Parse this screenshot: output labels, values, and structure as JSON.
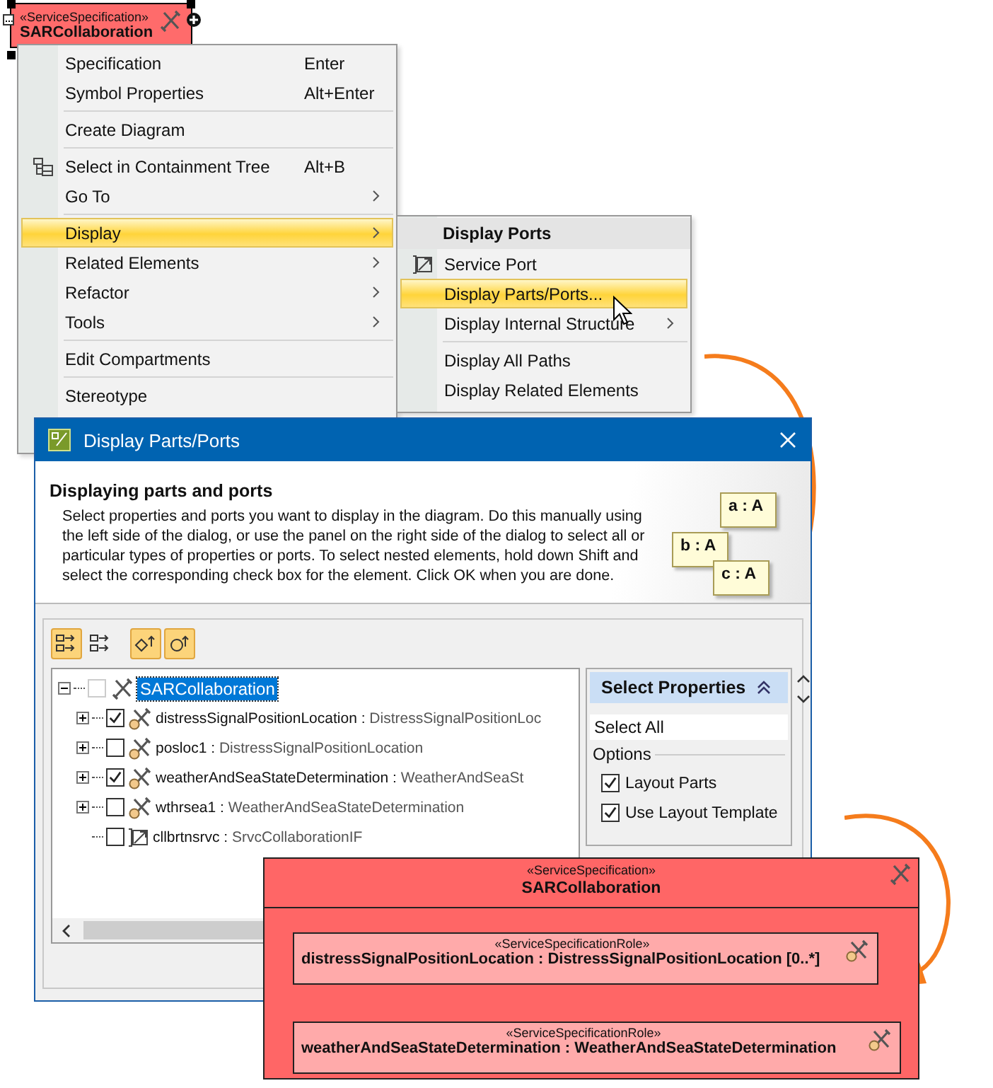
{
  "diagram_element": {
    "stereotype": "«ServiceSpecification»",
    "name": "SARCollaboration",
    "selected": true
  },
  "context_menu": {
    "groups": [
      [
        {
          "label": "Specification",
          "shortcut": "Enter",
          "has_icon": false,
          "has_submenu": false,
          "selected": false
        },
        {
          "label": "Symbol Properties",
          "shortcut": "Alt+Enter",
          "has_icon": false,
          "has_submenu": false,
          "selected": false
        }
      ],
      [
        {
          "label": "Create Diagram",
          "has_icon": false,
          "has_submenu": false,
          "selected": false
        }
      ],
      [
        {
          "label": "Select in Containment Tree",
          "shortcut": "Alt+B",
          "has_icon": true,
          "has_submenu": false,
          "selected": false
        },
        {
          "label": "Go To",
          "has_icon": false,
          "has_submenu": true,
          "selected": false
        }
      ],
      [
        {
          "label": "Display",
          "has_icon": false,
          "has_submenu": true,
          "selected": true
        },
        {
          "label": "Related Elements",
          "has_icon": false,
          "has_submenu": true,
          "selected": false
        },
        {
          "label": "Refactor",
          "has_icon": false,
          "has_submenu": true,
          "selected": false
        },
        {
          "label": "Tools",
          "has_icon": false,
          "has_submenu": true,
          "selected": false
        }
      ],
      [
        {
          "label": "Edit Compartments",
          "has_icon": false,
          "has_submenu": false,
          "selected": false
        }
      ],
      [
        {
          "label": "Stereotype",
          "has_icon": false,
          "has_submenu": false,
          "selected": false
        }
      ]
    ]
  },
  "submenu": {
    "header": "Display Ports",
    "groups": [
      [
        {
          "label": "Service Port",
          "has_icon": true,
          "has_submenu": false,
          "selected": false
        },
        {
          "label": "Display Parts/Ports...",
          "has_icon": false,
          "has_submenu": false,
          "selected": true
        },
        {
          "label": "Display Internal Structure",
          "has_icon": false,
          "has_submenu": true,
          "selected": false
        }
      ],
      [
        {
          "label": "Display All Paths",
          "has_icon": false,
          "has_submenu": false,
          "selected": false
        },
        {
          "label": "Display Related Elements",
          "has_icon": false,
          "has_submenu": false,
          "selected": false
        }
      ]
    ]
  },
  "dialog": {
    "title": "Display Parts/Ports",
    "heading": "Displaying parts and ports",
    "description": "Select properties and ports you want to display in the diagram. Do this manually using the left side of the dialog, or use the panel on the right side of the dialog to select all or particular types of properties or ports. To select nested elements, hold down Shift and select the corresponding check box for the element. Click OK when you are done.",
    "illustration_labels": [
      "a : A",
      "b : A",
      "c : A"
    ],
    "toolbar": [
      {
        "kind": "expand",
        "selected": true
      },
      {
        "kind": "collapse",
        "selected": false
      },
      {
        "kind": "part",
        "selected": true
      },
      {
        "kind": "port",
        "selected": true
      }
    ],
    "tree": {
      "name": "SARCollaboration",
      "checked": false,
      "expanded": true,
      "selected": true,
      "children": [
        {
          "name": "distressSignalPositionLocation :",
          "type": "DistressSignalPositionLoc",
          "kind": "part",
          "checked": true,
          "expanded": false
        },
        {
          "name": "posloc1 :",
          "type": "DistressSignalPositionLocation",
          "kind": "part",
          "checked": false,
          "expanded": false
        },
        {
          "name": "weatherAndSeaStateDetermination :",
          "type": "WeatherAndSeaSt",
          "kind": "part",
          "checked": true,
          "expanded": false
        },
        {
          "name": "wthrsea1 :",
          "type": "WeatherAndSeaStateDetermination",
          "kind": "part",
          "checked": false,
          "expanded": false
        },
        {
          "name": "cllbrtnsrvc :",
          "type": "SrvcCollaborationIF",
          "kind": "port",
          "checked": false
        }
      ]
    },
    "side_panel": {
      "title": "Select Properties",
      "select_all": "Select All",
      "options_label": "Options",
      "options": [
        {
          "label": "Layout Parts",
          "checked": true
        },
        {
          "label": "Use Layout Template",
          "checked": true
        }
      ]
    }
  },
  "result_diagram": {
    "stereotype": "«ServiceSpecification»",
    "name": "SARCollaboration",
    "parts": [
      {
        "stereotype": "«ServiceSpecificationRole»",
        "label": "distressSignalPositionLocation : DistressSignalPositionLocation [0..*]"
      },
      {
        "stereotype": "«ServiceSpecificationRole»",
        "label": "weatherAndSeaStateDetermination : WeatherAndSeaStateDetermination"
      }
    ]
  }
}
